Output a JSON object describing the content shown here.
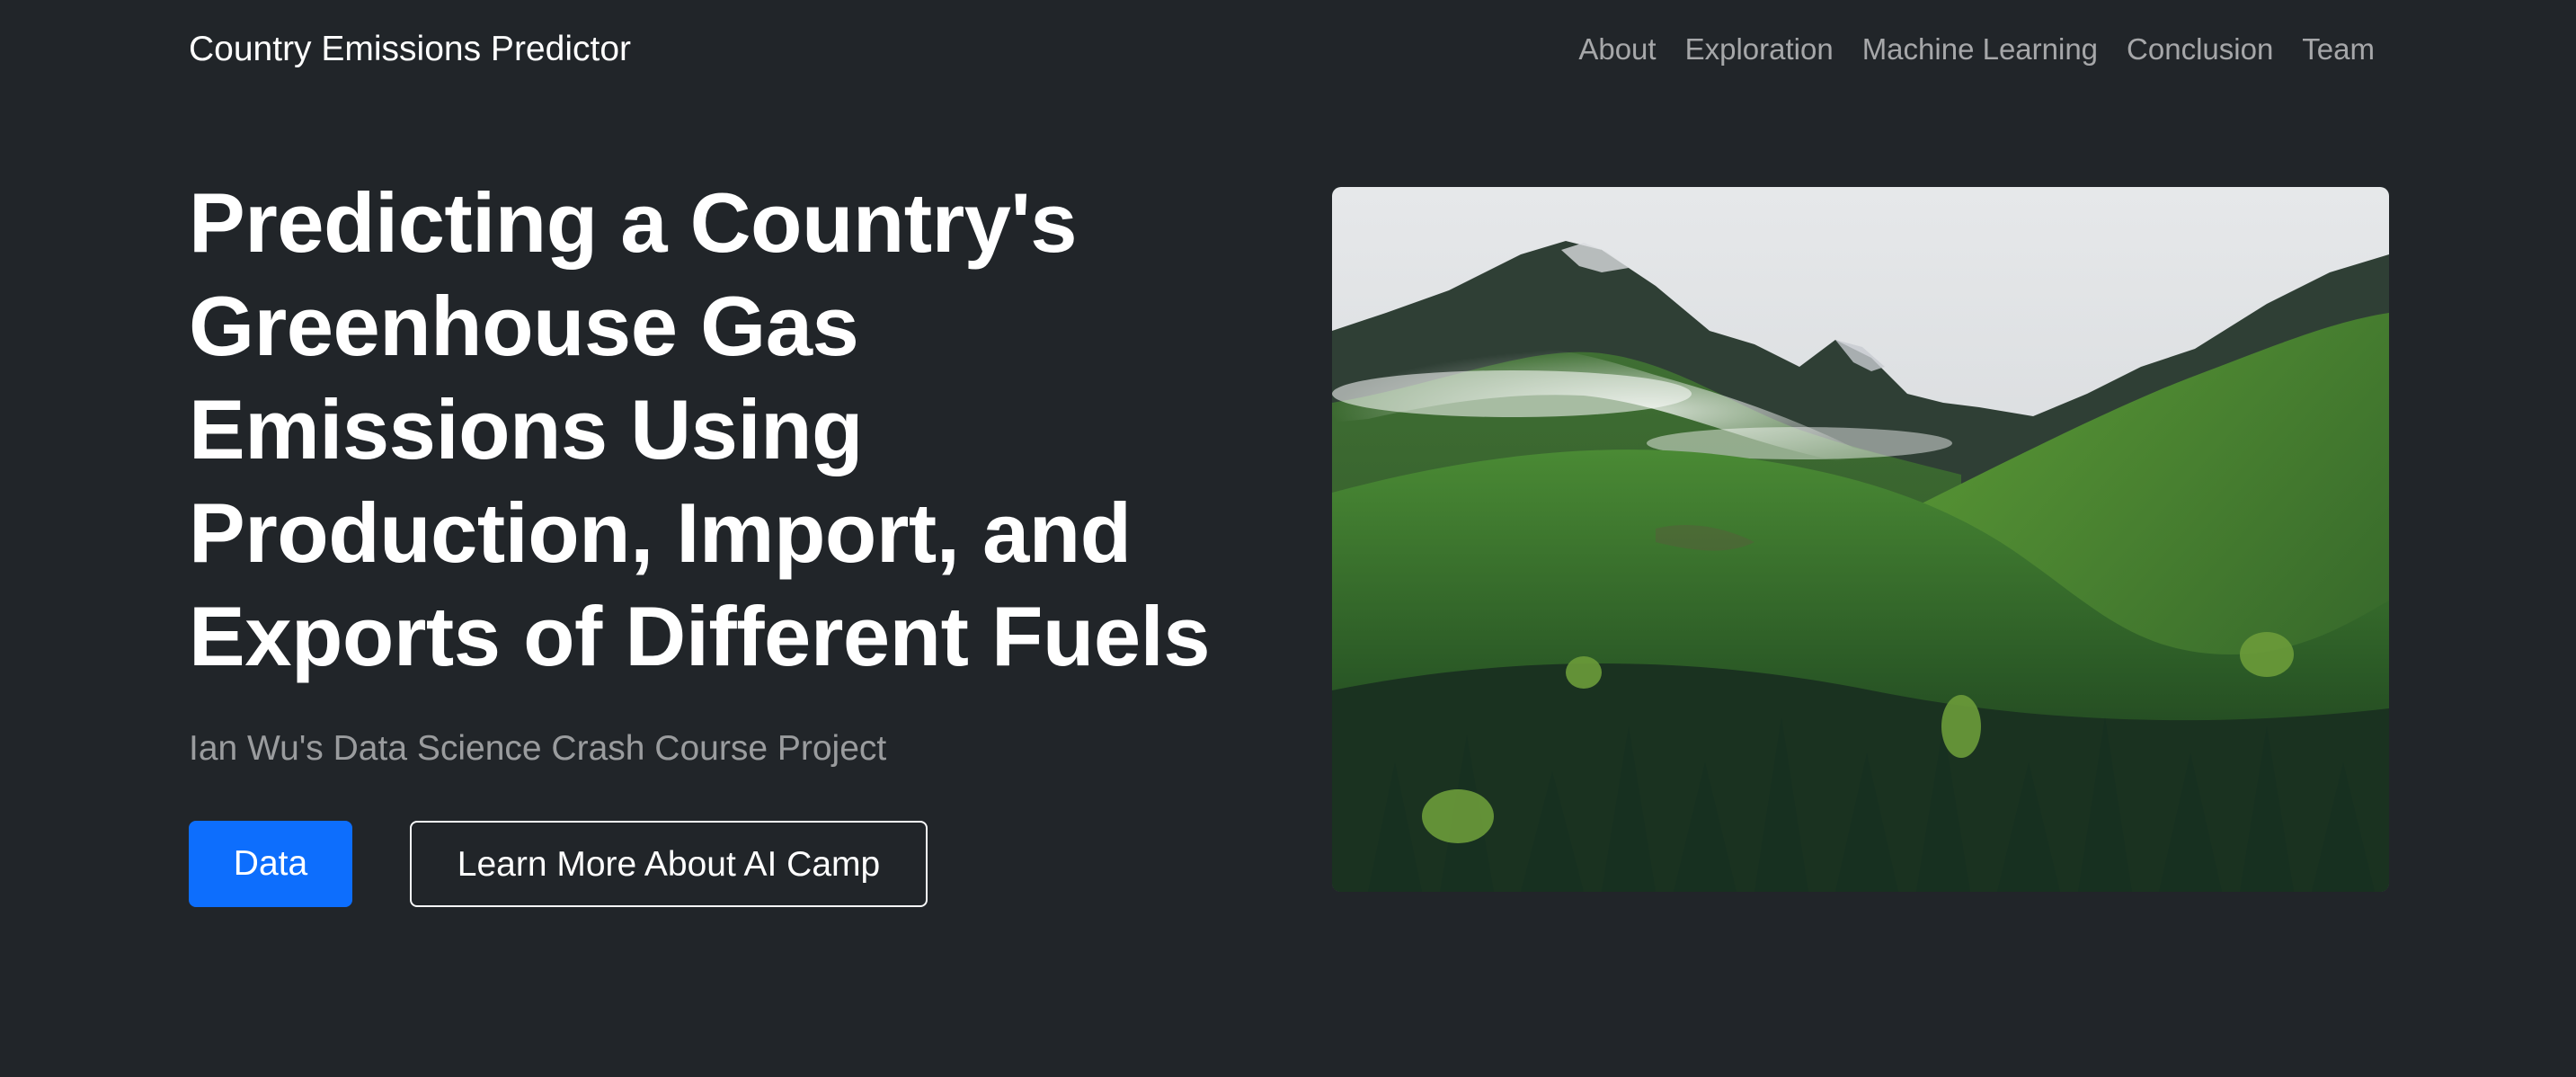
{
  "navbar": {
    "brand": "Country Emissions Predictor",
    "links": [
      {
        "label": "About"
      },
      {
        "label": "Exploration"
      },
      {
        "label": "Machine Learning"
      },
      {
        "label": "Conclusion"
      },
      {
        "label": "Team"
      }
    ]
  },
  "hero": {
    "title_lines": [
      "Predicting a Country's",
      "Greenhouse Gas",
      "Emissions Using",
      "Production, Import, and",
      "Exports of Different Fuels"
    ],
    "subtitle": "Ian Wu's Data Science Crash Course Project",
    "primary_button": "Data",
    "secondary_button": "Learn More About AI Camp",
    "image_subject": "misty-forested-mountains-photo"
  },
  "colors": {
    "background": "#212529",
    "primary": "#0d6efd",
    "nav_link": "rgba(255,255,255,0.60)",
    "subtitle": "rgba(255,255,255,0.55)"
  }
}
